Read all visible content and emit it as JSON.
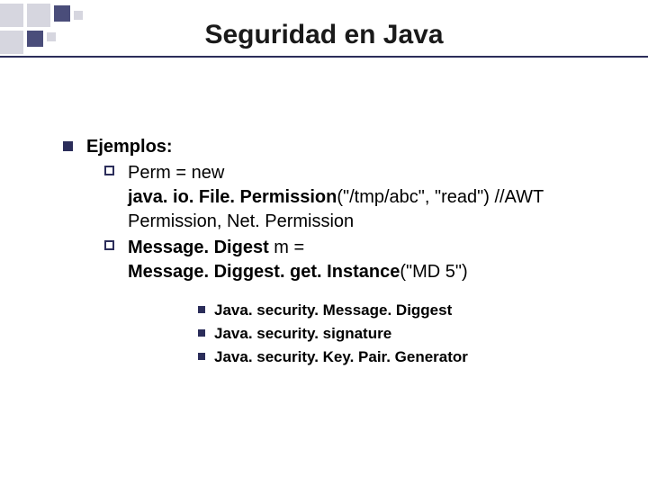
{
  "title": "Seguridad en Java",
  "l1": {
    "heading": "Ejemplos:"
  },
  "l2a": {
    "lead": "Perm",
    "rest": " = new",
    "line2a": "java. io. File. Permission",
    "line2b": "(\"/tmp/abc\", \"read\") //AWT",
    "line3": "Permission, Net. Permission"
  },
  "l2b": {
    "part1": "Message. Digest",
    "part2": " m =",
    "line2a": "Message. Diggest. get. Instance",
    "line2b": "(\"MD 5\")"
  },
  "l3": [
    "Java. security. Message. Diggest",
    "Java. security. signature",
    "Java. security. Key. Pair. Generator"
  ]
}
